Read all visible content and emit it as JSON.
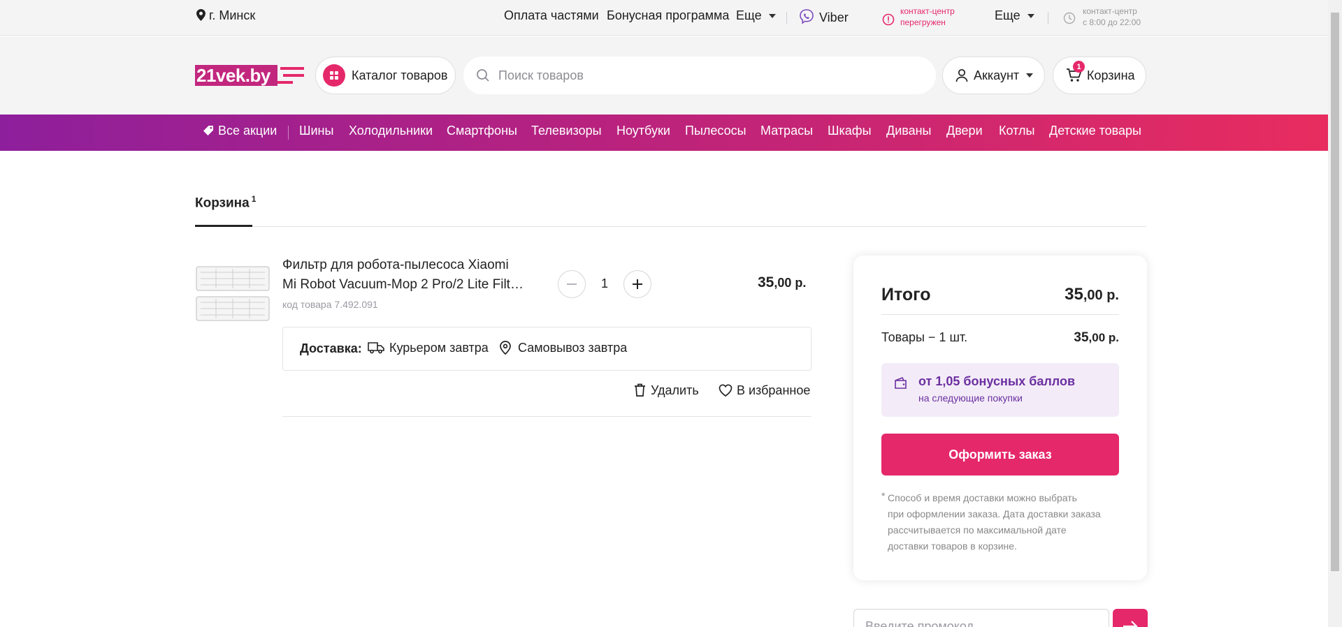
{
  "topbar": {
    "city": "г. Минск",
    "links": [
      "Оплата частями",
      "Бонусная программа"
    ],
    "more1": "Еще",
    "viber": "Viber",
    "contact_line1": "контакт-центр",
    "contact_line2": "перегружен",
    "more2": "Еще",
    "hours_line1": "контакт-центр",
    "hours_line2": "с 8:00 до 22:00"
  },
  "header": {
    "logo": "21vek.by",
    "catalog": "Каталог товаров",
    "search_placeholder": "Поиск товаров",
    "account": "Аккаунт",
    "cart": "Корзина",
    "cart_count": "1"
  },
  "nav": {
    "items": [
      "Все акции",
      "Шины",
      "Холодильники",
      "Смартфоны",
      "Телевизоры",
      "Ноутбуки",
      "Пылесосы",
      "Матрасы",
      "Шкафы",
      "Диваны",
      "Двери",
      "Котлы",
      "Детские товары"
    ]
  },
  "cart": {
    "title": "Корзина",
    "count": "1",
    "item": {
      "name_line1": "Фильтр для робота-пылесоса Xiaomi",
      "name_line2": "Mi Robot Vacuum-Mop 2 Pro/2 Lite Filt…",
      "code": "код товара 7.492.091",
      "qty": "1",
      "price_int": "35",
      "price_dec": ",00 р.",
      "delivery_label": "Доставка:",
      "delivery_courier": "Курьером завтра",
      "delivery_pickup": "Самовывоз завтра",
      "delete": "Удалить",
      "favorite": "В избранное"
    }
  },
  "summary": {
    "total_label": "Итого",
    "total_int": "35",
    "total_dec": ",00 р.",
    "goods_label": "Товары − 1 шт.",
    "goods_int": "35",
    "goods_dec": ",00 р.",
    "bonus_title": "от 1,05 бонусных баллов",
    "bonus_sub": "на следующие покупки",
    "order_button": "Оформить заказ",
    "note_star": "*",
    "note_line1": "Способ и время доставки можно выбрать",
    "note_line2": "при оформлении заказа. Дата доставки заказа",
    "note_line3": "рассчитывается по максимальной дате",
    "note_line4": "доставки товаров в корзине."
  },
  "promo": {
    "placeholder": "Введите промокод"
  },
  "colors": {
    "accent": "#e5286a",
    "nav_start": "#8e1f9c",
    "nav_end": "#e82c5f",
    "bonus_text": "#6b2fa0"
  }
}
